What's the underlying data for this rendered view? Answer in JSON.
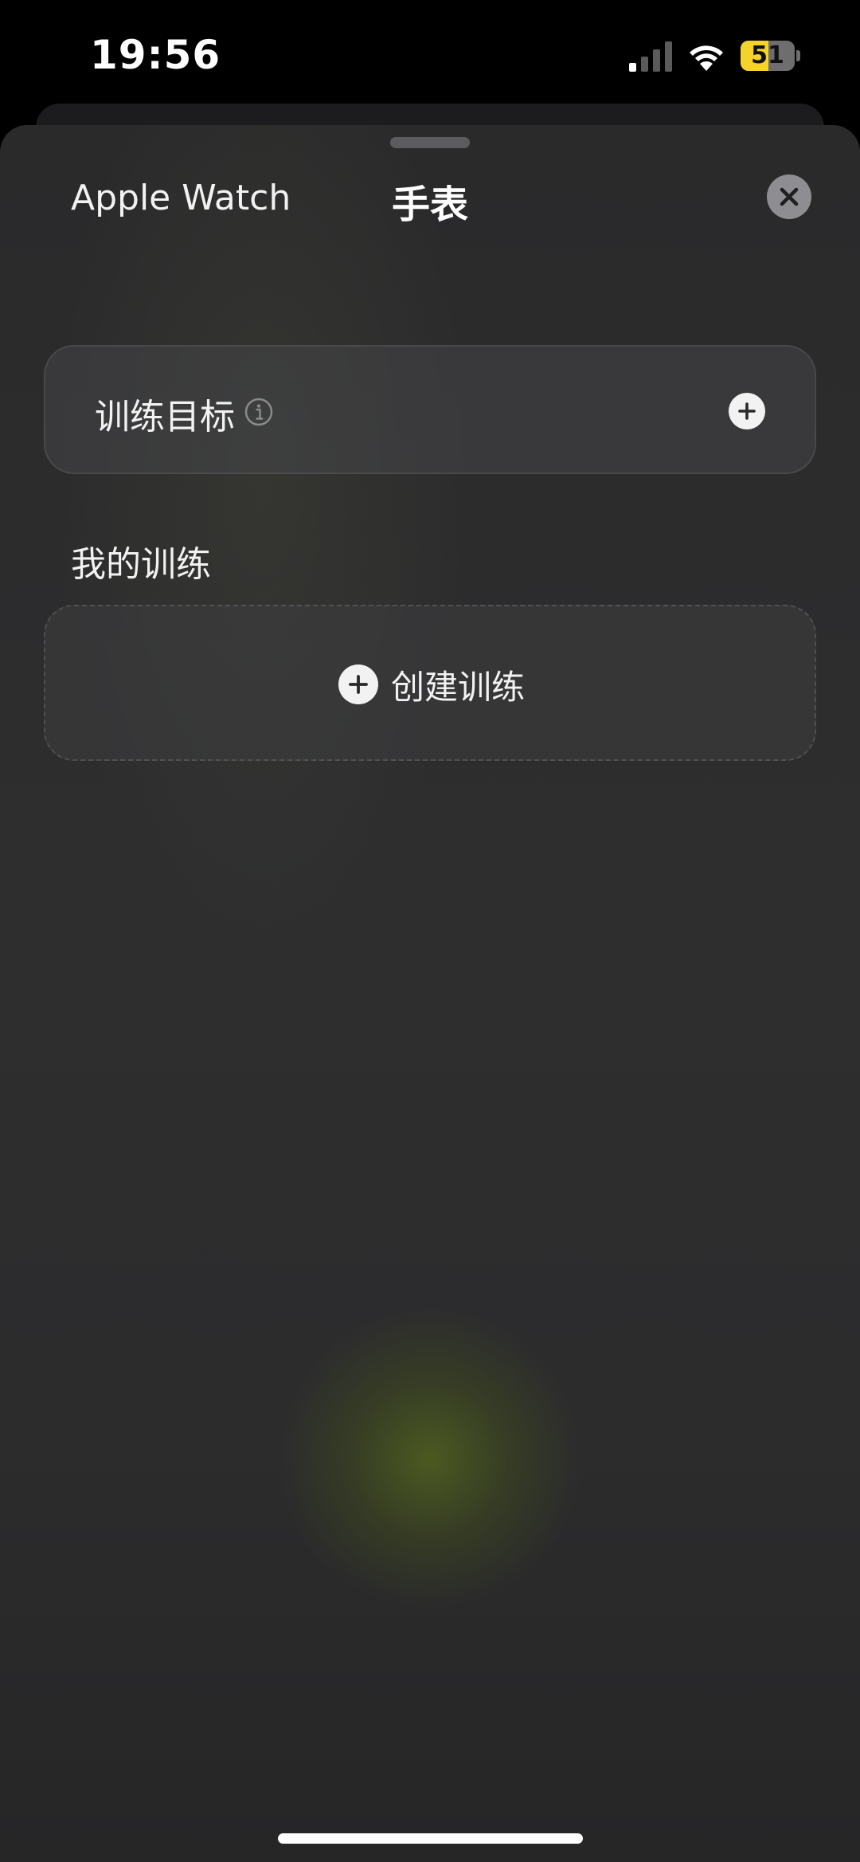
{
  "status_bar": {
    "time": "19:56",
    "battery_level": "51",
    "battery_fraction": 0.51,
    "signal_bars": 1,
    "signal_icon": "cellular-signal-icon",
    "wifi_icon": "wifi-icon"
  },
  "sheet": {
    "title": "手表",
    "close_icon": "close-icon"
  },
  "apple_watch": {
    "section_label": "Apple Watch",
    "goal_label": "训练目标",
    "info_icon": "info-icon",
    "add_icon": "plus-icon"
  },
  "my_workouts": {
    "section_label": "我的训练",
    "create_label": "创建训练",
    "add_icon": "plus-icon"
  },
  "colors": {
    "background": "#2c2c2d",
    "card": "#3a3a3c",
    "battery_accent": "#f5d328",
    "glow": "#5c721a"
  }
}
